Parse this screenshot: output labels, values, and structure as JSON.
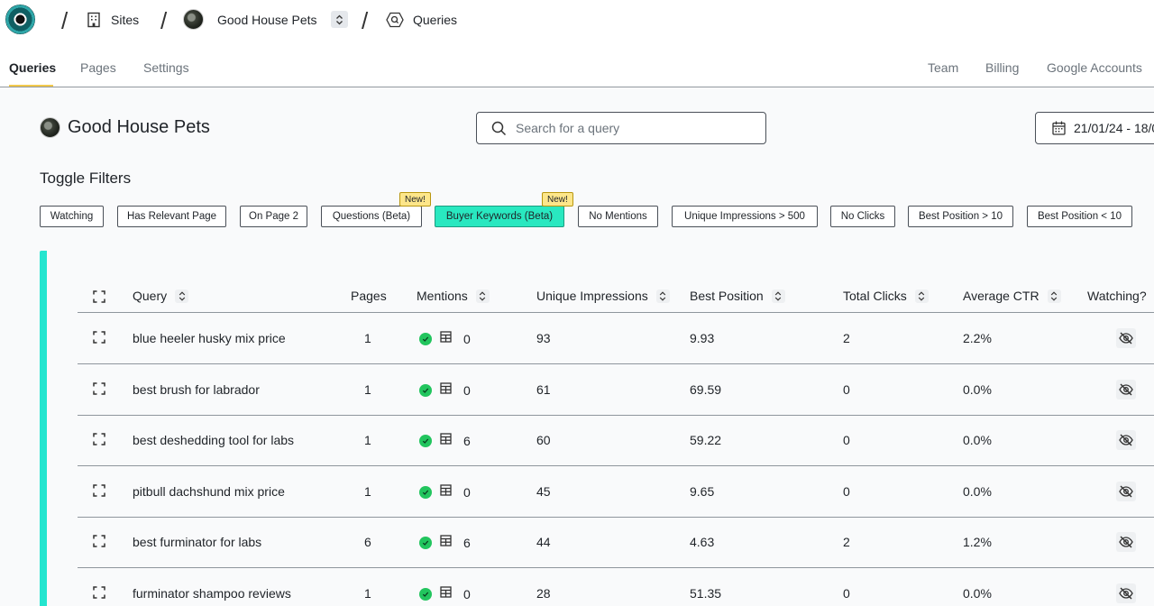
{
  "breadcrumb": {
    "sites_label": "Sites",
    "site_name": "Good House Pets",
    "page_label": "Queries"
  },
  "tabs": {
    "left": [
      {
        "label": "Queries",
        "active": true
      },
      {
        "label": "Pages",
        "active": false
      },
      {
        "label": "Settings",
        "active": false
      }
    ],
    "right": [
      {
        "label": "Team"
      },
      {
        "label": "Billing"
      },
      {
        "label": "Google Accounts"
      }
    ]
  },
  "header": {
    "site_title": "Good House Pets",
    "search_placeholder": "Search for a query",
    "date_range": "21/01/24 - 18/0"
  },
  "filters": {
    "title": "Toggle Filters",
    "new_badge": "New!",
    "chips": [
      {
        "label": "Watching"
      },
      {
        "label": "Has Relevant Page"
      },
      {
        "label": "On Page 2"
      },
      {
        "label": "Questions (Beta)",
        "new": true
      },
      {
        "label": "Buyer Keywords (Beta)",
        "new": true,
        "active": true
      },
      {
        "label": "No Mentions"
      },
      {
        "label": "Unique Impressions > 500"
      },
      {
        "label": "No Clicks"
      },
      {
        "label": "Best Position > 10"
      },
      {
        "label": "Best Position < 10"
      }
    ]
  },
  "table": {
    "columns": {
      "query": "Query",
      "pages": "Pages",
      "mentions": "Mentions",
      "unique_impressions": "Unique Impressions",
      "best_position": "Best Position",
      "total_clicks": "Total Clicks",
      "average_ctr": "Average CTR",
      "watching": "Watching?"
    },
    "rows": [
      {
        "query": "blue heeler husky mix price",
        "pages": "1",
        "mentions": "0",
        "impressions": "93",
        "best_position": "9.93",
        "clicks": "2",
        "ctr": "2.2%"
      },
      {
        "query": "best brush for labrador",
        "pages": "1",
        "mentions": "0",
        "impressions": "61",
        "best_position": "69.59",
        "clicks": "0",
        "ctr": "0.0%"
      },
      {
        "query": "best deshedding tool for labs",
        "pages": "1",
        "mentions": "6",
        "impressions": "60",
        "best_position": "59.22",
        "clicks": "0",
        "ctr": "0.0%"
      },
      {
        "query": "pitbull dachshund mix price",
        "pages": "1",
        "mentions": "0",
        "impressions": "45",
        "best_position": "9.65",
        "clicks": "0",
        "ctr": "0.0%"
      },
      {
        "query": "best furminator for labs",
        "pages": "6",
        "mentions": "6",
        "impressions": "44",
        "best_position": "4.63",
        "clicks": "2",
        "ctr": "1.2%"
      },
      {
        "query": "furminator shampoo reviews",
        "pages": "1",
        "mentions": "0",
        "impressions": "28",
        "best_position": "51.35",
        "clicks": "0",
        "ctr": "0.0%"
      }
    ]
  },
  "colors": {
    "accent": "#24e5cf",
    "active_chip": "#29e8c0",
    "new_badge": "#fde68a",
    "check": "#22c55e",
    "tab_underline": "#f2c94c"
  }
}
